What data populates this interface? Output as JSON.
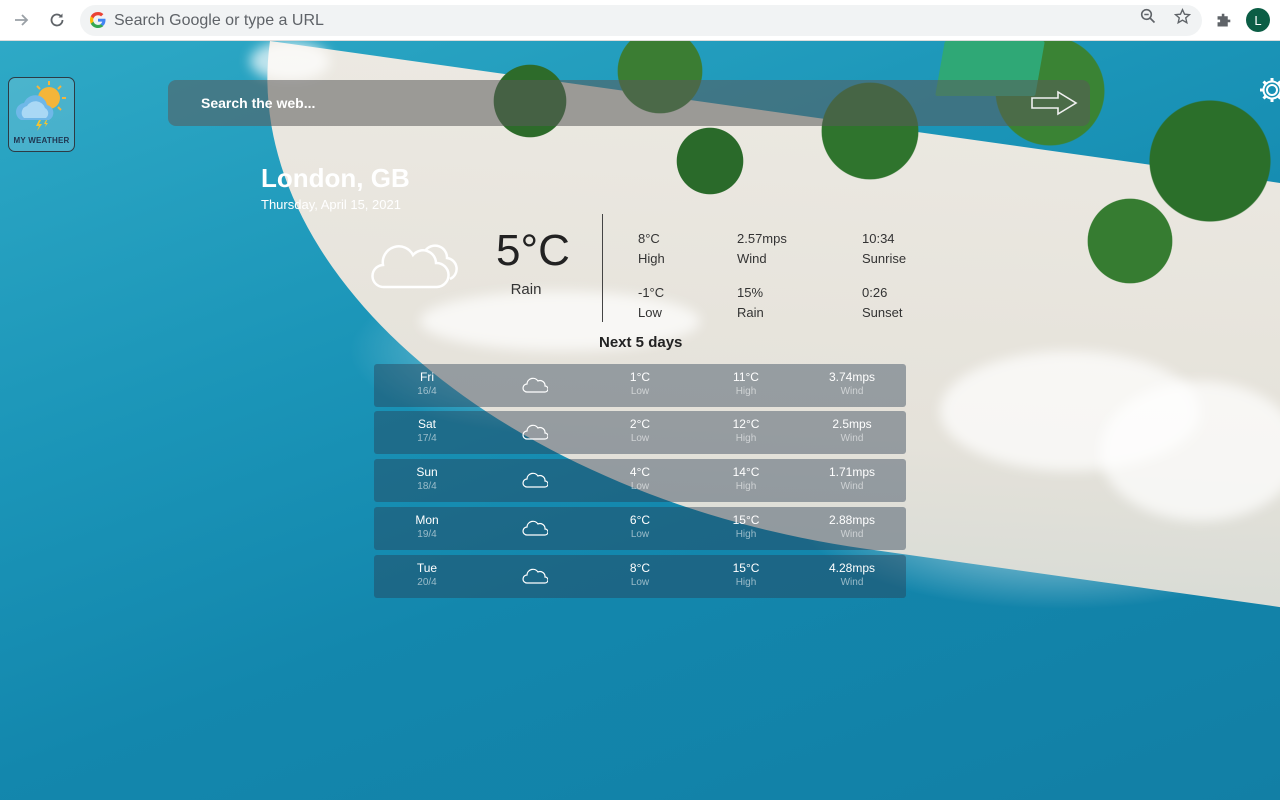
{
  "browser": {
    "omnibox_placeholder": "Search Google or type a URL",
    "avatar_letter": "L"
  },
  "app": {
    "logo_text": "MY WEATHER",
    "search_placeholder": "Search the web..."
  },
  "weather": {
    "city": "London, GB",
    "date": "Thursday, April 15, 2021",
    "temp": "5°C",
    "condition": "Rain",
    "stats": [
      {
        "value": "8°C",
        "label": "High"
      },
      {
        "value": "2.57mps",
        "label": "Wind"
      },
      {
        "value": "10:34",
        "label": "Sunrise"
      },
      {
        "value": "-1°C",
        "label": "Low"
      },
      {
        "value": "15%",
        "label": "Rain"
      },
      {
        "value": "0:26",
        "label": "Sunset"
      }
    ]
  },
  "forecast": {
    "title": "Next 5 days",
    "days": [
      {
        "day": "Fri",
        "date": "16/4",
        "icon": "cloud-icon",
        "low": "1°C",
        "low_label": "Low",
        "high": "11°C",
        "high_label": "High",
        "wind": "3.74mps",
        "wind_label": "Wind"
      },
      {
        "day": "Sat",
        "date": "17/4",
        "icon": "cloud-icon",
        "low": "2°C",
        "low_label": "Low",
        "high": "12°C",
        "high_label": "High",
        "wind": "2.5mps",
        "wind_label": "Wind"
      },
      {
        "day": "Sun",
        "date": "18/4",
        "icon": "cloud-icon",
        "low": "4°C",
        "low_label": "Low",
        "high": "14°C",
        "high_label": "High",
        "wind": "1.71mps",
        "wind_label": "Wind"
      },
      {
        "day": "Mon",
        "date": "19/4",
        "icon": "cloud-icon",
        "low": "6°C",
        "low_label": "Low",
        "high": "15°C",
        "high_label": "High",
        "wind": "2.88mps",
        "wind_label": "Wind"
      },
      {
        "day": "Tue",
        "date": "20/4",
        "icon": "cloud-icon",
        "low": "8°C",
        "low_label": "Low",
        "high": "15°C",
        "high_label": "High",
        "wind": "4.28mps",
        "wind_label": "Wind"
      }
    ]
  },
  "colors": {
    "ocean": "#1b95b8",
    "sand": "#e8e5de",
    "avatar_bg": "#0b5d45"
  }
}
